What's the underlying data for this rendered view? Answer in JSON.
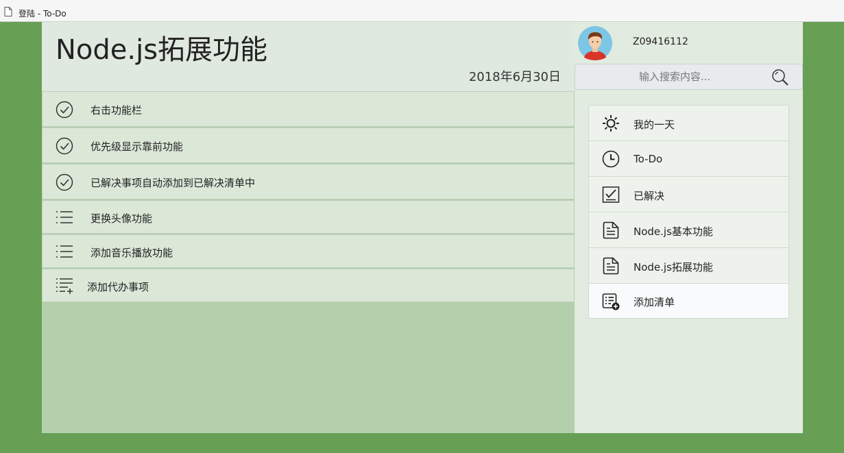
{
  "window": {
    "title": "登陆 - To-Do",
    "page_icon": "document-icon"
  },
  "main": {
    "list_title": "Node.js拓展功能",
    "date": "2018年6月30日",
    "tasks": [
      {
        "label": "右击功能栏",
        "icon": "check-circle-icon",
        "completed": true
      },
      {
        "label": "优先级显示靠前功能",
        "icon": "check-circle-icon",
        "completed": true
      },
      {
        "label": "已解决事项自动添加到已解决清单中",
        "icon": "check-circle-icon",
        "completed": true
      },
      {
        "label": "更换头像功能",
        "icon": "list-icon",
        "completed": false
      },
      {
        "label": "添加音乐播放功能",
        "icon": "list-icon",
        "completed": false
      }
    ],
    "add_task_label": "添加代办事项"
  },
  "sidebar": {
    "user": {
      "name": "Z09416112",
      "avatar": "avatar-icon"
    },
    "search": {
      "placeholder": "输入搜索内容...",
      "value": ""
    },
    "nav": [
      {
        "label": "我的一天",
        "icon": "sun-icon"
      },
      {
        "label": "To-Do",
        "icon": "clock-icon"
      },
      {
        "label": "已解决",
        "icon": "checklist-icon"
      },
      {
        "label": "Node.js基本功能",
        "icon": "document-icon"
      },
      {
        "label": "Node.js拓展功能",
        "icon": "document-icon"
      }
    ],
    "add_list_label": "添加清单"
  },
  "colors": {
    "background": "#67a055",
    "main_panel": "#b3cfab",
    "header": "#dfe9df",
    "task_row": "#dbe8d8",
    "sidebar": "#e2ebdf"
  }
}
